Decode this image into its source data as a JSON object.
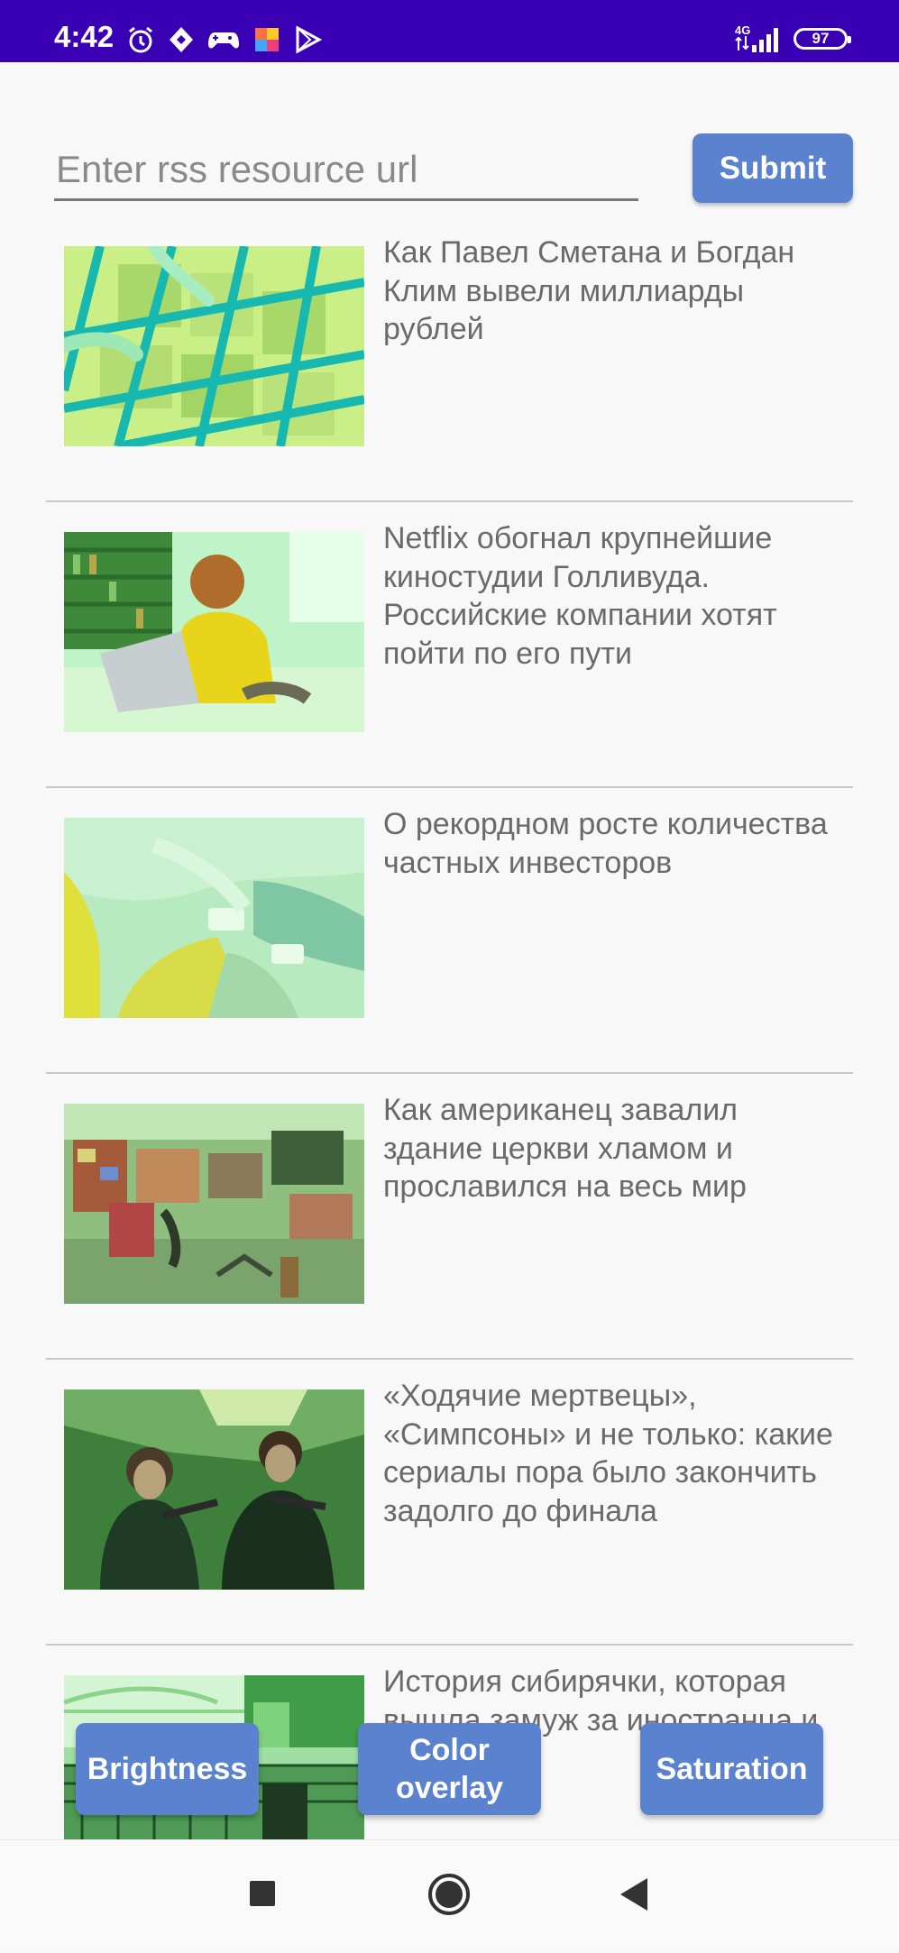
{
  "status_bar": {
    "time": "4:42",
    "icons": [
      "alarm-icon",
      "shield-icon",
      "gamepad-icon",
      "app-icon",
      "play-store-icon"
    ],
    "network": "4G",
    "battery": "97"
  },
  "url_bar": {
    "placeholder": "Enter rss resource url",
    "value": "",
    "submit_label": "Submit"
  },
  "feed": {
    "items": [
      {
        "title": "Как Павел Сметана и Богдан Клим вывели миллиарды рублей",
        "image": "money-trays-photo"
      },
      {
        "title": "Netflix обогнал крупнейшие киностудии Голливуда. Российские компании хотят пойти по его пути",
        "image": "woman-laptop-photo"
      },
      {
        "title": "О рекордном росте количества частных инвесторов",
        "image": "people-phones-photo"
      },
      {
        "title": "Как американец завалил здание церкви хламом и прославился на весь мир",
        "image": "cluttered-room-photo"
      },
      {
        "title": "«Ходячие мертвецы», «Симпсоны» и не только: какие сериалы пора было закончить задолго до финала",
        "image": "tv-series-photo"
      },
      {
        "title": "История сибирячки, которая вышла замуж за иностранца и переехала",
        "image": "city-bridge-photo"
      }
    ]
  },
  "filters": {
    "brightness": "Brightness",
    "color_overlay": "Color overlay",
    "saturation": "Saturation"
  },
  "nav": {
    "recents": "recents-icon",
    "home": "home-icon",
    "back": "back-icon"
  },
  "colors": {
    "status_bar": "#3a00b3",
    "accent": "#5b82cf",
    "image_tint": "#53d35a"
  }
}
